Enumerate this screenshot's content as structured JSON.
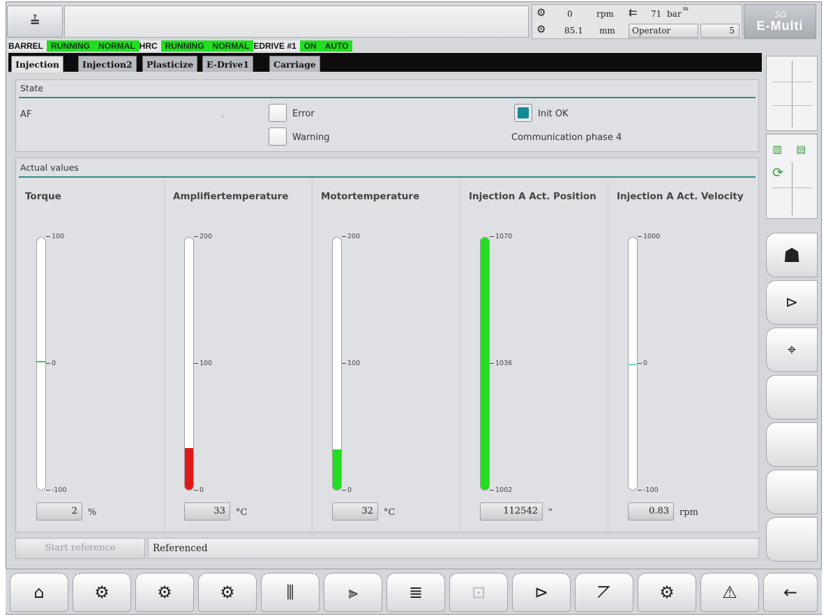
{
  "header": {
    "help_icon": "help-context-icon",
    "help_text": "≟",
    "status": {
      "screw_speed_value": "0",
      "screw_speed_unit": "rpm",
      "pressure_value": "71",
      "pressure_unit": "bar",
      "pressure_sup": "m",
      "position_value": "85.1",
      "position_unit": "mm",
      "operator": "Operator",
      "level": "5"
    },
    "logo_text": "E-Multi",
    "logo_top": "ᏚᏀ"
  },
  "strip": [
    {
      "text": "BARREL",
      "green": false
    },
    {
      "text": "RUNNING",
      "green": true
    },
    {
      "text": "NORMAL",
      "green": true
    },
    {
      "text": "HRC",
      "green": false
    },
    {
      "text": "RUNNING",
      "green": true
    },
    {
      "text": "NORMAL",
      "green": true
    },
    {
      "text": "EDRIVE #1",
      "green": false
    },
    {
      "text": "ON",
      "green": true
    },
    {
      "text": "AUTO",
      "green": true
    }
  ],
  "tabs": [
    "Injection",
    "Injection2",
    "Plasticize",
    "E-Drive1",
    "Carriage"
  ],
  "state": {
    "title": "State",
    "af": "AF",
    "dot": ".",
    "error_label": "Error",
    "warning_label": "Warning",
    "init_ok_label": "Init OK",
    "communication": "Communication phase 4",
    "error_checked": false,
    "warning_checked": false,
    "init_ok_checked": true
  },
  "actual": {
    "title": "Actual values",
    "gauges": [
      {
        "title": "Torque",
        "max": "100",
        "mid": "0",
        "min": "-100",
        "value": "2",
        "unit": "%",
        "fill_fraction": 0,
        "marker_fraction": 0.51,
        "color": "#22dd22"
      },
      {
        "title": "Amplifiertemperature",
        "max": "200",
        "mid": "100",
        "min": "0",
        "value": "33",
        "unit": "°C",
        "fill_fraction": 0.165,
        "color": "#e0191b"
      },
      {
        "title": "Motortemperature",
        "max": "200",
        "mid": "100",
        "min": "0",
        "value": "32",
        "unit": "°C",
        "fill_fraction": 0.16,
        "color": "#22dd22"
      },
      {
        "title": "Injection A Act. Position",
        "max": "1070",
        "mid": "1036",
        "min": "1002",
        "value": "112542",
        "unit": "\"",
        "fill_fraction": 1.0,
        "color": "#22dd22"
      },
      {
        "title": "Injection A Act. Velocity",
        "max": "1000",
        "mid": "0",
        "min": "-100",
        "value": "0.83",
        "unit": "rpm",
        "fill_fraction": 0,
        "marker_fraction": 0.5,
        "color": "#7fd6c8"
      }
    ]
  },
  "bottom": {
    "start_reference": "Start reference",
    "referenced": "Referenced"
  },
  "sidebar": {
    "icons": [
      "barrel-heating-icon",
      "mold-icon",
      "cycle-icon",
      "operator-icon",
      "ejector-icon",
      "chart-user-icon"
    ]
  },
  "nav": {
    "icons": [
      "home-icon",
      "injection-unit-icon",
      "barrel-icon",
      "nozzle-icon",
      "temperature-icon",
      "injection-profile-icon",
      "list-icon",
      "robot-icon",
      "mold-open-icon",
      "graph-icon",
      "settings-icon",
      "alarm-icon",
      "back-icon"
    ]
  }
}
